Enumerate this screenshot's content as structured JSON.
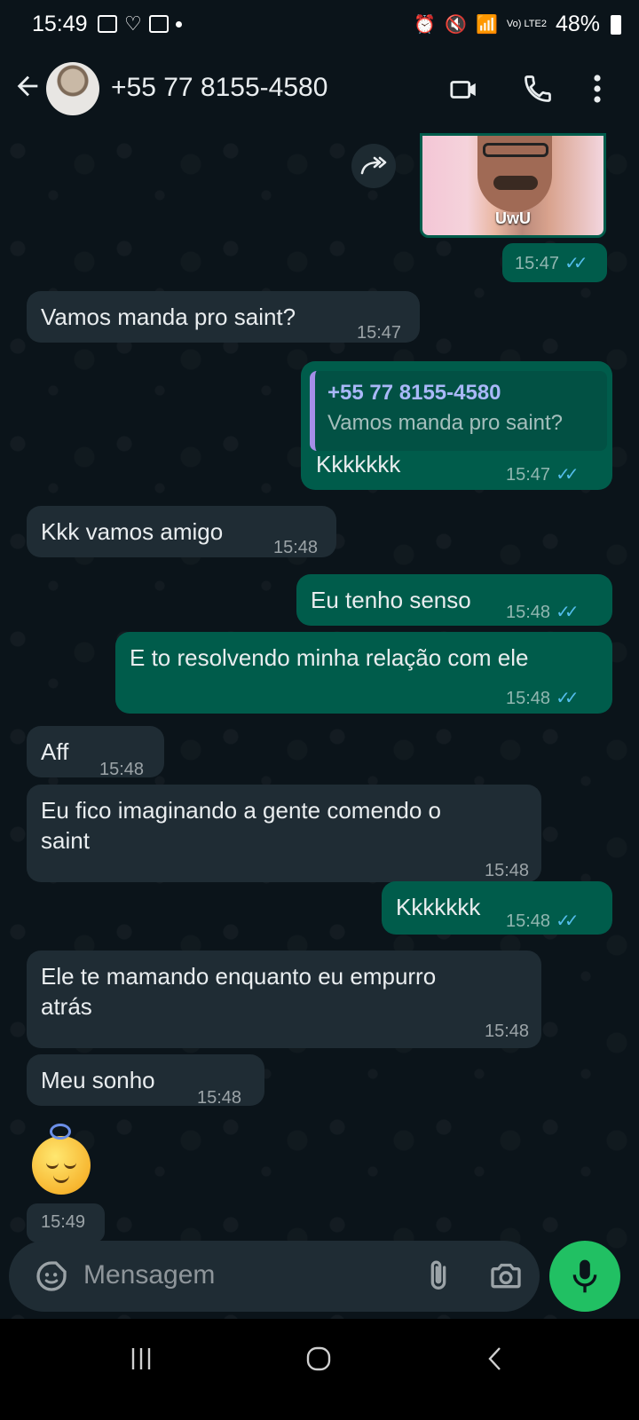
{
  "status_bar": {
    "time": "15:49",
    "network": "Vo) LTE2",
    "battery": "48%"
  },
  "header": {
    "contact_name": "+55 77 8155-4580"
  },
  "messages": {
    "image": {
      "caption": "UwU",
      "time": "15:47"
    },
    "m1": {
      "text": "Vamos manda pro saint?",
      "time": "15:47"
    },
    "m2": {
      "quote_author": "+55 77 8155-4580",
      "quote_text": "Vamos manda pro saint?",
      "text": "Kkkkkkk",
      "time": "15:47"
    },
    "m3": {
      "text": "Kkk vamos amigo",
      "time": "15:48"
    },
    "m4": {
      "text": "Eu tenho senso",
      "time": "15:48"
    },
    "m5": {
      "text": "E to resolvendo minha relação com ele",
      "time": "15:48"
    },
    "m6": {
      "text": "Aff",
      "time": "15:48"
    },
    "m7": {
      "text_line1": "Eu fico imaginando a gente comendo o",
      "text_line2": "saint",
      "time": "15:48"
    },
    "m8": {
      "text": "Kkkkkkk",
      "time": "15:48"
    },
    "m9": {
      "text_line1": "Ele te mamando enquanto eu empurro",
      "text_line2": "atrás",
      "time": "15:48"
    },
    "m10": {
      "text": "Meu sonho",
      "time": "15:48"
    },
    "m11": {
      "emoji": "innocent-face",
      "time": "15:49"
    }
  },
  "input": {
    "placeholder": "Mensagem"
  },
  "colors": {
    "background": "#0b141a",
    "incoming_bubble": "#1f2c34",
    "outgoing_bubble": "#005c4b",
    "read_ticks": "#53bdeb",
    "mic_button": "#21c063"
  },
  "icons": [
    "back-arrow-icon",
    "video-call-icon",
    "phone-icon",
    "more-vert-icon",
    "forward-icon",
    "sticker-icon",
    "attach-icon",
    "camera-icon",
    "mic-icon"
  ]
}
